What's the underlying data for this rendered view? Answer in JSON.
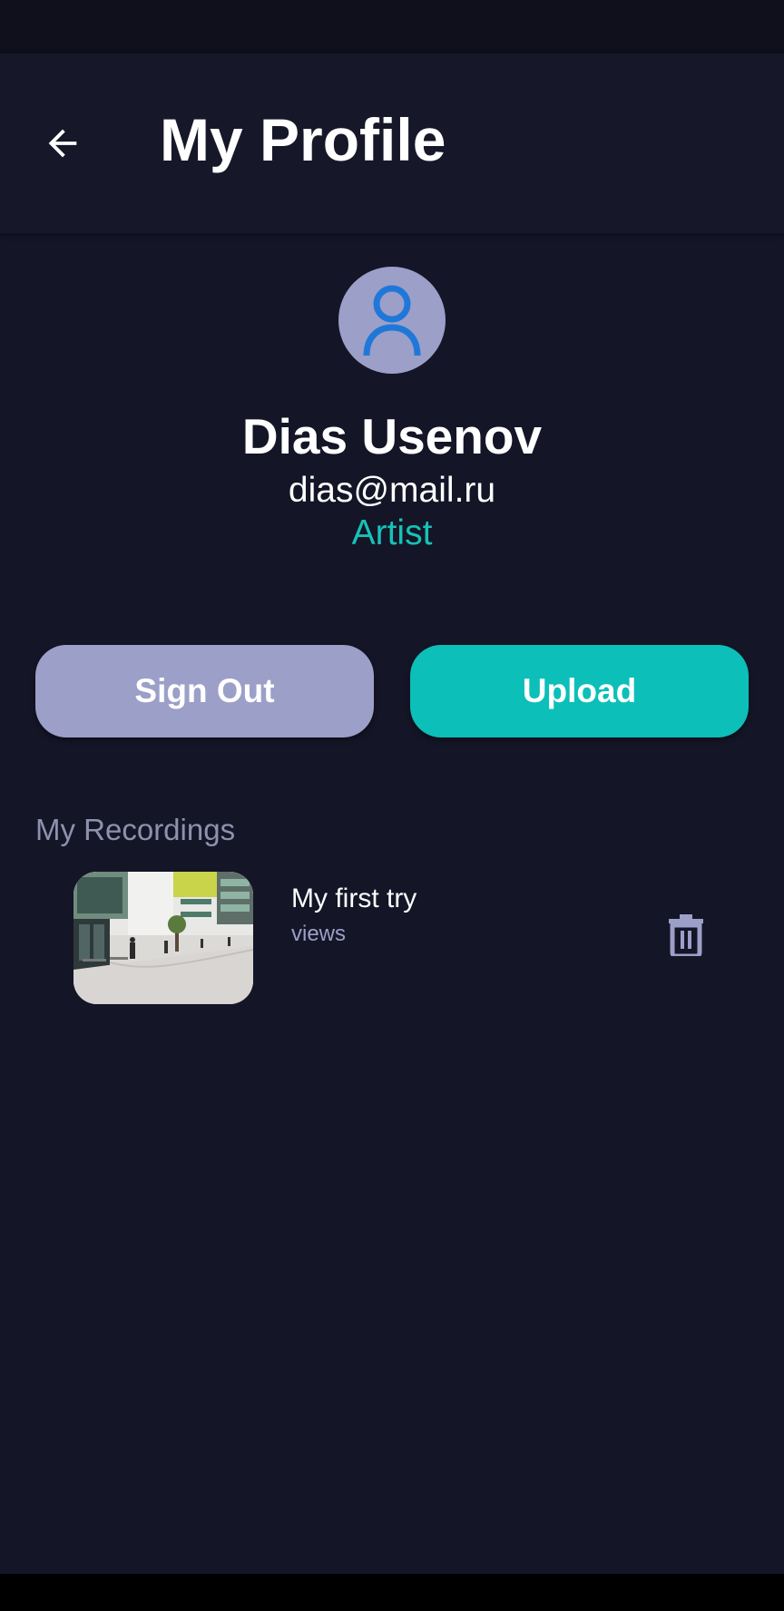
{
  "header": {
    "title": "My Profile",
    "back_icon": "arrow-back-icon"
  },
  "profile": {
    "avatar_icon": "person-icon",
    "name": "Dias Usenov",
    "email": "dias@mail.ru",
    "role": "Artist"
  },
  "actions": {
    "sign_out_label": "Sign Out",
    "upload_label": "Upload"
  },
  "recordings": {
    "section_title": "My Recordings",
    "items": [
      {
        "title": "My first try",
        "subtitle": "views",
        "delete_icon": "trash-icon"
      }
    ]
  },
  "colors": {
    "background": "#141526",
    "app_bar": "#161829",
    "accent_teal": "#0cbfb9",
    "accent_lavender": "#9c9fc8",
    "avatar_glyph": "#1f78d8"
  }
}
